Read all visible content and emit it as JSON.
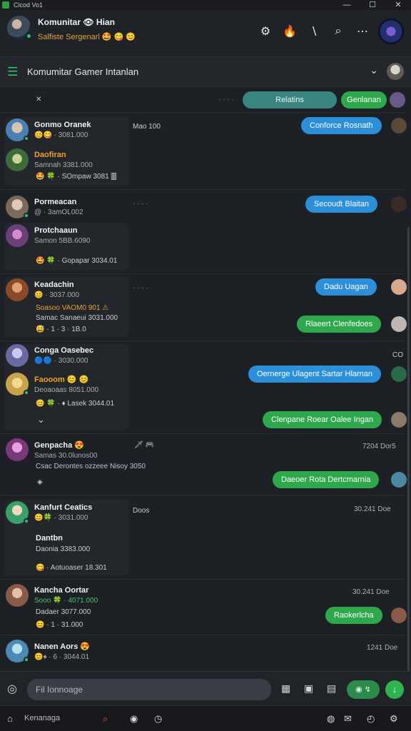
{
  "window": {
    "title": "Cicod Vo1",
    "app_icon": "app-icon",
    "controls": [
      "—",
      "☐",
      "✕"
    ]
  },
  "header": {
    "name": "Komunitar 👁 Hian",
    "status": "Salfiste Sergenarl 🤩 😋 😊",
    "icons": [
      "gear-icon",
      "flame-icon",
      "edit-icon",
      "search-icon",
      "more-icon"
    ]
  },
  "group": {
    "name": "Komumitar Gamer Intanlan"
  },
  "top_row": {
    "left_mark": "✕",
    "dots": "· · · ·",
    "pill_teal": "Relatins",
    "pill_green": "Genlanan"
  },
  "rows": [
    {
      "users": [
        {
          "name": "Gonmo Oranek",
          "sub": "😊😋 · 3081.000",
          "color": "#4a7fb5"
        },
        {
          "name": "Daofiran",
          "sub": "Samnah 3381.000",
          "color": "#3e6b3a",
          "orange": true
        }
      ],
      "footer": "🤩 🍀 · SOmpaw 3081 🀫",
      "meta": "Mao 100",
      "bubbles": [
        {
          "text": "Conforce Rosnath",
          "color": "blue"
        }
      ]
    },
    {
      "users": [
        {
          "name": "Pormeacan",
          "sub": "@ · 3amOL002",
          "color": "#7a6a5a"
        },
        {
          "name": "Protchaaun",
          "sub": "Samon 5BB.6090",
          "color": "#6a3f7a"
        }
      ],
      "footer": "🤩 🍀 · Gopapar 3034.01",
      "meta": "· · · ·",
      "bubbles": [
        {
          "text": "Secoudt Blaitan",
          "color": "blue"
        }
      ]
    },
    {
      "users": [
        {
          "name": "Keadachin",
          "sub": "😊 · 3037.000",
          "color": "#8a4a2a"
        }
      ],
      "lines": [
        "Soasoo VAOM0 901 ⚠",
        "Samac Sanaeui 3031.000",
        "😅 · 1 · 3 · 1B.0"
      ],
      "meta": "· · · ·",
      "bubbles": [
        {
          "text": "Dadu Uagan",
          "color": "blue"
        },
        {
          "text": "Rlaeert Clenfedoes",
          "color": "green"
        }
      ]
    },
    {
      "users": [
        {
          "name": "Conga Oasebec",
          "sub": "🔵🔵 · 3030.000",
          "color": "#6a6aa0"
        },
        {
          "name": "Faooom 😊 😊",
          "sub": "Deoaoaas 8051.000",
          "color": "#c9a34a",
          "orange": true
        }
      ],
      "footer": "😊 🍀 · ♦ Lasek 3044.01",
      "chev": "⌄",
      "meta": "CO",
      "bubbles": [
        {
          "text": "Oernerge Ulagent Sartar Hlarnan",
          "color": "blue"
        },
        {
          "text": "Clenpane Roear Oalee Ingan",
          "color": "green"
        }
      ]
    },
    {
      "users": [
        {
          "name": "Genpacha 😍",
          "sub": "Samas 30.0lunos00",
          "color": "#7a3a7a"
        }
      ],
      "lines": [
        "Csac Derontes ozzeee Nisoy 3050"
      ],
      "footer": "◈",
      "meta": "🗡 🎮",
      "time": "7204 Dor5",
      "bubbles": [
        {
          "text": "Daeoer Rota Dertcmarnia",
          "color": "green"
        }
      ]
    },
    {
      "users": [
        {
          "name": "Kanfurt Ceatics",
          "sub": "😊🍀 · 3031.000",
          "color": "#3aa06a"
        }
      ],
      "lines": [
        "Dantbn",
        "Daonia 3383.000"
      ],
      "footer": "😋 · Aotuoaser 18.301",
      "meta": "Doos",
      "time": "30.241 Doe"
    },
    {
      "users": [
        {
          "name": "Kancha Oortar",
          "sub": "Sooo 🍀 · 4071.000",
          "color": "#8a5a4a"
        }
      ],
      "lines": [
        "Dadaer 3077.000",
        "😊 · 1 · 31.000"
      ],
      "time": "30.241 Doe",
      "bubbles": [
        {
          "text": "Raokerlcha",
          "color": "green"
        }
      ]
    },
    {
      "users": [
        {
          "name": "Nanen Aors 😍",
          "sub": "😊♦ · 6 · 3044.01",
          "color": "#4a8ab5"
        }
      ],
      "time": "1241 Doe"
    }
  ],
  "composer": {
    "placeholder": "Fil Ionnoage",
    "voice": "◉ ↯",
    "send_icon": "send-icon"
  },
  "bottombar": {
    "label": "Kenanaga",
    "icons": [
      "search-icon",
      "record-icon",
      "clock-icon",
      "chrome-icon",
      "mail-icon",
      "alarm-icon",
      "settings-icon"
    ]
  }
}
